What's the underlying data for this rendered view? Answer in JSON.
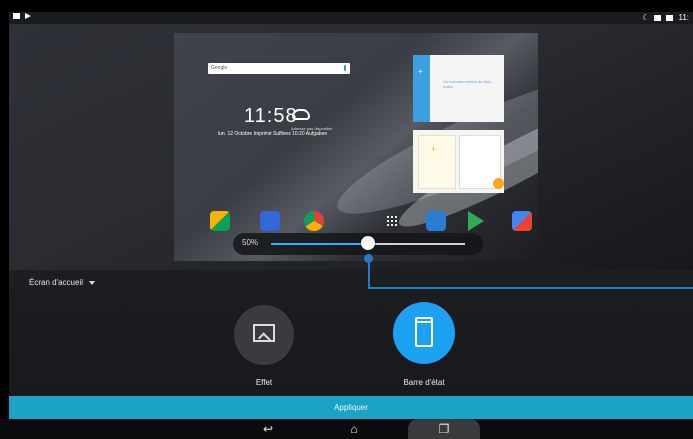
{
  "status_bar": {
    "time": "11:"
  },
  "preview": {
    "search_label": "Google",
    "clock": "11:58",
    "weather_label": "Adresse pas disponible",
    "date": "lun. 12 Octobre Imprimé Suffixes 10:20 Aufgaben",
    "widget1_text": "Un nouveau mémo du bloc-notes",
    "slider_value": "50%",
    "slider_fraction": 0.5
  },
  "toolbar": {
    "screen_selector": "Écran d'accueil"
  },
  "options": [
    {
      "label": "Effet",
      "icon": "image-edit-icon"
    },
    {
      "label": "Barre d'état",
      "icon": "tablet-icon"
    }
  ],
  "apply_label": "Appliquer",
  "nav": {
    "back": "↩",
    "home": "⌂",
    "recents": "❐"
  },
  "colors": {
    "accent": "#1da1f2",
    "apply_bar": "#1ca2c4",
    "callout": "#1f7fc2"
  }
}
